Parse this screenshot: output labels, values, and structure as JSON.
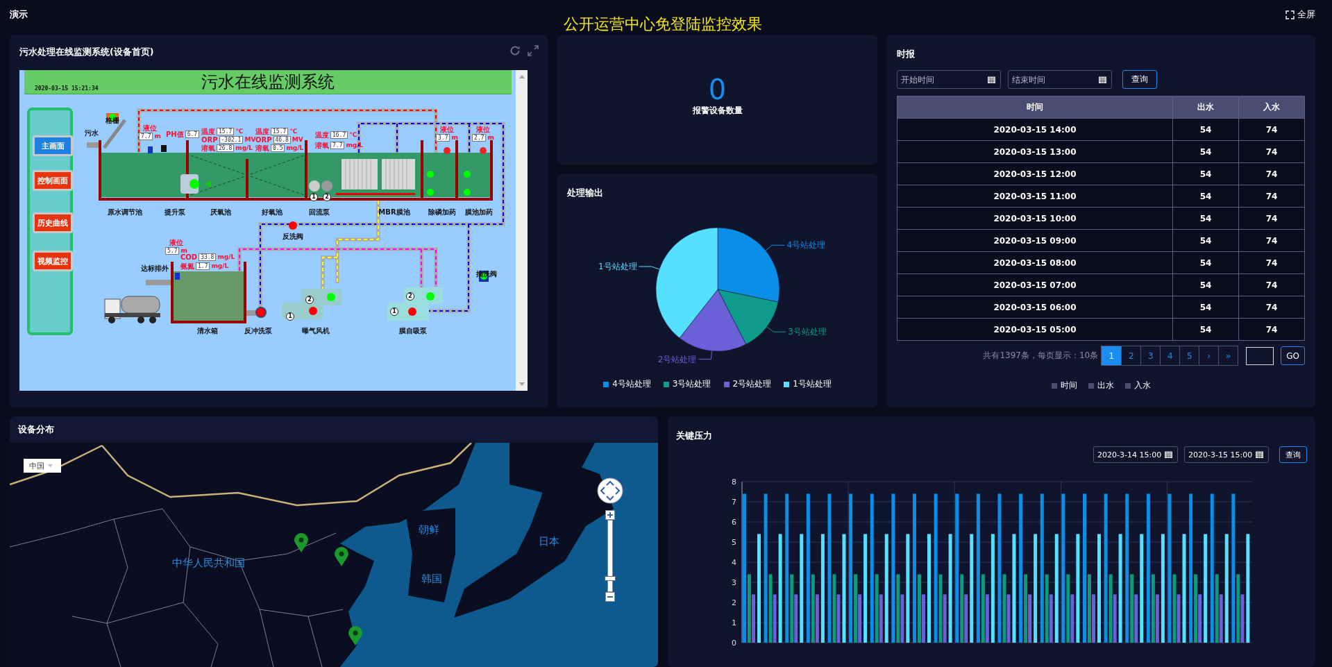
{
  "header": {
    "label": "演示",
    "title": "公开运营中心免登陆监控效果",
    "fullscreen": "全屏"
  },
  "scada_panel": {
    "title": "污水处理在线监测系统(设备首页)",
    "screen": {
      "title": "污水在线监测系统",
      "timestamp": "2020-03-15 15:21:34",
      "nav_buttons": [
        {
          "label": "主画面",
          "selected": true
        },
        {
          "label": "控制画面",
          "selected": false
        },
        {
          "label": "历史曲线",
          "selected": false
        },
        {
          "label": "视频监控",
          "selected": false
        }
      ],
      "readings": [
        {
          "kind": "stacked",
          "label": "液位",
          "value": "7.7",
          "unit": "m"
        },
        {
          "kind": "inline",
          "label": "PH值",
          "value": "6.7"
        },
        {
          "kind": "inline",
          "label": "温度",
          "value": "15.7",
          "unit": "℃"
        },
        {
          "kind": "inline",
          "label": "ORP",
          "value": "-302.1",
          "unit": "MV"
        },
        {
          "kind": "inline",
          "label": "溶氧",
          "value": "26.8",
          "unit": "mg/L"
        },
        {
          "kind": "inline",
          "label": "温度",
          "value": "15.7",
          "unit": "℃"
        },
        {
          "kind": "inline",
          "label": "ORP",
          "value": "46.8",
          "unit": "MV"
        },
        {
          "kind": "inline",
          "label": "溶氧",
          "value": "0.5",
          "unit": "mg/L"
        },
        {
          "kind": "inline",
          "label": "温度",
          "value": "16.7",
          "unit": "℃"
        },
        {
          "kind": "inline",
          "label": "溶氧",
          "value": "7.7",
          "unit": "mg/L"
        },
        {
          "kind": "stacked",
          "label": "液位",
          "value": "3.7",
          "unit": "m"
        },
        {
          "kind": "stacked",
          "label": "液位",
          "value": "2.7",
          "unit": "m"
        },
        {
          "kind": "stacked",
          "label": "液位",
          "value": "5.7",
          "unit": "m"
        },
        {
          "kind": "inline",
          "label": "COD",
          "value": "33.8",
          "unit": "mg/L"
        },
        {
          "kind": "inline",
          "label": "氨氮",
          "value": "1.7",
          "unit": "mg/L"
        }
      ],
      "labels": [
        "污水",
        "格栅",
        "原水调节池",
        "提升泵",
        "厌氧池",
        "好氧池",
        "回流泵",
        "MBR膜池",
        "除磷加药",
        "膜池加药",
        "反洗阀",
        "达标排外",
        "清水箱",
        "反冲洗泵",
        "曝气风机",
        "膜自吸泵",
        "抽洗阀"
      ],
      "pump_numbers": [
        "1",
        "2",
        "1",
        "2",
        "1",
        "2"
      ]
    }
  },
  "alarm_card": {
    "value": "0",
    "label": "报警设备数量"
  },
  "output_panel": {
    "title": "处理输出",
    "chart_data": {
      "type": "pie",
      "categories": [
        "4号站处理",
        "3号站处理",
        "2号站处理",
        "1号站处理"
      ],
      "values": [
        28,
        14,
        18,
        39
      ]
    },
    "legend": [
      {
        "label": "4号站处理",
        "color": "#0a8ee8"
      },
      {
        "label": "3号站处理",
        "color": "#0e9a8c"
      },
      {
        "label": "2号站处理",
        "color": "#6a60d8"
      },
      {
        "label": "1号站处理",
        "color": "#56e0ff"
      }
    ]
  },
  "report_panel": {
    "title": "时报",
    "start_placeholder": "开始时间",
    "end_placeholder": "结束时间",
    "query": "查询",
    "columns": [
      "时间",
      "出水",
      "入水"
    ],
    "rows": [
      [
        "2020-03-15 14:00",
        "54",
        "74"
      ],
      [
        "2020-03-15 13:00",
        "54",
        "74"
      ],
      [
        "2020-03-15 12:00",
        "54",
        "74"
      ],
      [
        "2020-03-15 11:00",
        "54",
        "74"
      ],
      [
        "2020-03-15 10:00",
        "54",
        "74"
      ],
      [
        "2020-03-15 09:00",
        "54",
        "74"
      ],
      [
        "2020-03-15 08:00",
        "54",
        "74"
      ],
      [
        "2020-03-15 07:00",
        "54",
        "74"
      ],
      [
        "2020-03-15 06:00",
        "54",
        "74"
      ],
      [
        "2020-03-15 05:00",
        "54",
        "74"
      ]
    ],
    "pagination": {
      "summary": "共有1397条，每页显示：10条",
      "pages": [
        {
          "label": "1",
          "selected": true
        },
        {
          "label": "2",
          "selected": false
        },
        {
          "label": "3",
          "selected": false
        },
        {
          "label": "4",
          "selected": false
        },
        {
          "label": "5",
          "selected": false
        }
      ],
      "next": "›",
      "last": "»",
      "go": "GO"
    },
    "legend": [
      "时间",
      "出水",
      "入水"
    ]
  },
  "map_panel": {
    "title": "设备分布",
    "region": "中国",
    "zoom": {
      "level": 0.18
    },
    "labels": [
      "中华人民共和国",
      "朝鲜",
      "韩国",
      "日本"
    ]
  },
  "pressure_panel": {
    "title": "关键压力",
    "start": "2020-3-14 15:00",
    "end": "2020-3-15 15:00",
    "query": "查询",
    "chart_data": {
      "type": "bar",
      "grid": true,
      "ylim": [
        0,
        8
      ],
      "yticks": [
        0,
        1,
        2,
        3,
        4,
        5,
        6,
        7,
        8
      ],
      "series": [
        {
          "color": "#0a8ee8",
          "values": [
            7.4,
            7.4,
            7.4,
            7.4,
            7.4,
            7.4,
            7.4,
            7.4,
            7.4,
            7.4,
            7.4,
            7.4,
            7.4,
            7.4,
            7.4,
            7.4,
            7.4,
            7.4,
            7.4,
            7.4,
            7.4,
            7.4,
            7.4,
            7.4
          ]
        },
        {
          "color": "#0e9a7c",
          "values": [
            3.4,
            3.4,
            3.4,
            3.4,
            3.4,
            3.4,
            3.4,
            3.4,
            3.4,
            3.4,
            3.4,
            3.4,
            3.4,
            3.4,
            3.4,
            3.4,
            3.4,
            3.4,
            3.4,
            3.4,
            3.4,
            3.4,
            3.4,
            3.4
          ]
        },
        {
          "color": "#6a60d8",
          "values": [
            2.4,
            2.4,
            2.4,
            2.4,
            2.4,
            2.4,
            2.4,
            2.4,
            2.4,
            2.4,
            2.4,
            2.4,
            2.4,
            2.4,
            2.4,
            2.4,
            2.4,
            2.4,
            2.4,
            2.4,
            2.4,
            2.4,
            2.4,
            2.4
          ]
        },
        {
          "color": "#56e0ff",
          "values": [
            5.4,
            5.4,
            5.4,
            5.4,
            5.4,
            5.4,
            5.4,
            5.4,
            5.4,
            5.4,
            5.4,
            5.4,
            5.4,
            5.4,
            5.4,
            5.4,
            5.4,
            5.4,
            5.4,
            5.4,
            5.4,
            5.4,
            5.4,
            5.4
          ]
        }
      ]
    }
  }
}
